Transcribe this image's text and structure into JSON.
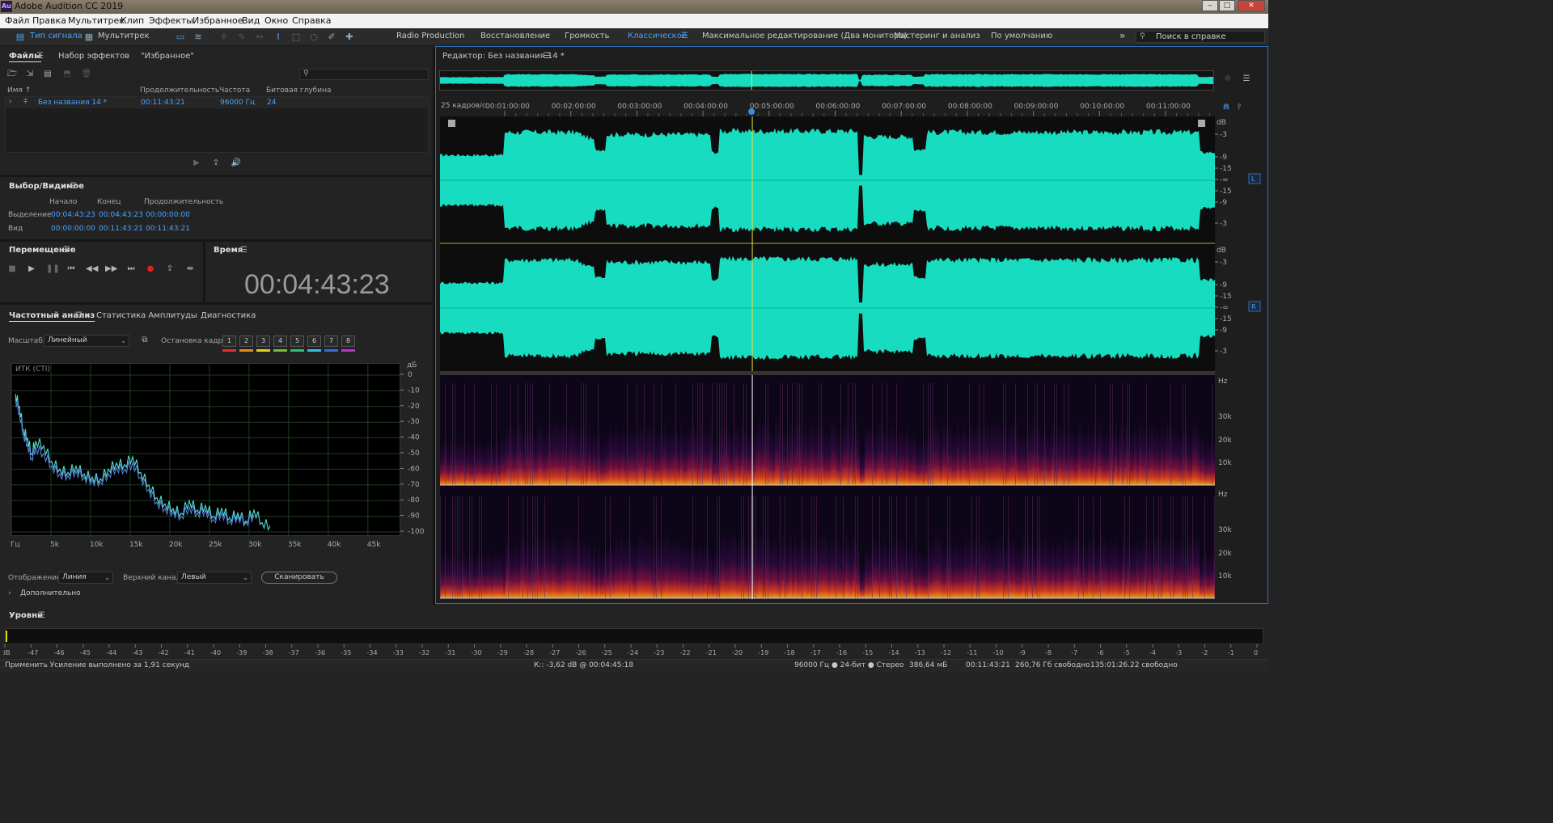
{
  "window": {
    "title": "Adobe Audition CC 2019",
    "app_icon": "Au",
    "min": "‒",
    "max": "□",
    "close": "✕"
  },
  "menu": [
    "Файл",
    "Правка",
    "Мультитрек",
    "Клип",
    "Эффекты",
    "Избранное",
    "Вид",
    "Окно",
    "Справка"
  ],
  "toolbar": {
    "waveform_mode": "Тип сигнала",
    "multitrack_mode": "Мультитрек",
    "workspaces": [
      "Radio Production",
      "Восстановление",
      "Громкость",
      "Классическое",
      "Максимальное редактирование (Два монитора)",
      "Мастеринг и анализ",
      "По умолчанию"
    ],
    "active_workspace": "Классическое",
    "more": "»",
    "search_placeholder": "Поиск в справке"
  },
  "files_panel": {
    "tabs": [
      "Файлы",
      "Набор эффектов",
      "\"Избранное\""
    ],
    "columns": [
      "Имя ↑",
      "Продолжительность",
      "Частота",
      "Битовая глубина"
    ],
    "rows": [
      {
        "name": "Без названия 14 *",
        "duration": "00:11:43:21",
        "rate": "96000 Гц",
        "depth": "24"
      }
    ]
  },
  "selection_panel": {
    "title": "Выбор/Видимое",
    "headers": [
      "Начало",
      "Конец",
      "Продолжительность"
    ],
    "rows": [
      {
        "label": "Выделение",
        "start": "00:04:43:23",
        "end": "00:04:43:23",
        "duration": "00:00:00:00"
      },
      {
        "label": "Вид",
        "start": "00:00:00:00",
        "end": "00:11:43:21",
        "duration": "00:11:43:21"
      }
    ]
  },
  "transport": {
    "title": "Перемещение"
  },
  "time_panel": {
    "title": "Время",
    "time": "00:04:43:23"
  },
  "analysis": {
    "tabs": [
      "Частотный анализ",
      "Статистика Амплитуды",
      "Диагностика"
    ],
    "scale_label": "Масштаб:",
    "scale_value": "Линейный",
    "freeze_label": "Остановка кадра:",
    "freeze_frames": [
      "1",
      "2",
      "3",
      "4",
      "5",
      "6",
      "7",
      "8"
    ],
    "freeze_colors": [
      "#e03030",
      "#e08a20",
      "#e0d020",
      "#70c030",
      "#30c070",
      "#30c0e0",
      "#3070e0",
      "#c030d0"
    ],
    "display_label": "Отображение:",
    "display_value": "Линия",
    "channel_label": "Верхний канал:",
    "channel_value": "Левый",
    "scan_label": "Сканировать",
    "more_label": "Дополнительно"
  },
  "chart_data": {
    "type": "line",
    "title": "ИТК (CTI)",
    "xlabel": "",
    "ylabel": "дБ",
    "x_ticks": [
      "Гц",
      "5k",
      "10k",
      "15k",
      "20k",
      "25k",
      "30k",
      "35k",
      "40k",
      "45k"
    ],
    "y_ticks": [
      "0",
      "-10",
      "-20",
      "-30",
      "-40",
      "-50",
      "-60",
      "-70",
      "-80",
      "-90",
      "-100"
    ],
    "xlim": [
      0,
      48000
    ],
    "ylim": [
      -100,
      0
    ],
    "grid": true,
    "series": [
      {
        "color": "#4fe0d0",
        "x": [
          500,
          1000,
          1500,
          2000,
          2500,
          3000,
          4000,
          5000,
          6000,
          7000,
          8000,
          9000,
          10000,
          11000,
          12000,
          13000,
          14000,
          15000,
          16000,
          17000,
          18000,
          19000,
          20000,
          21000,
          22000,
          23000,
          24000,
          25000,
          26000,
          27000,
          28000,
          29000,
          30000,
          31000,
          32000
        ],
        "y": [
          -12,
          -20,
          -35,
          -40,
          -50,
          -42,
          -45,
          -55,
          -60,
          -62,
          -58,
          -63,
          -65,
          -66,
          -60,
          -56,
          -57,
          -52,
          -62,
          -70,
          -78,
          -82,
          -85,
          -88,
          -80,
          -86,
          -83,
          -90,
          -85,
          -91,
          -88,
          -93,
          -86,
          -94,
          -96
        ]
      },
      {
        "color": "#5a7ad8",
        "x": [
          500,
          1000,
          1500,
          2000,
          2500,
          3000,
          4000,
          5000,
          6000,
          7000,
          8000,
          9000,
          10000,
          11000,
          12000,
          13000,
          14000,
          15000,
          16000,
          17000,
          18000,
          19000,
          20000,
          21000,
          22000,
          23000,
          24000,
          25000,
          26000,
          27000,
          28000,
          29000,
          30000
        ],
        "y": [
          -15,
          -24,
          -38,
          -44,
          -53,
          -46,
          -50,
          -58,
          -63,
          -64,
          -61,
          -65,
          -67,
          -68,
          -63,
          -59,
          -60,
          -56,
          -65,
          -73,
          -81,
          -85,
          -87,
          -90,
          -84,
          -88,
          -86,
          -92,
          -88,
          -93,
          -90,
          -94,
          -89
        ]
      }
    ]
  },
  "editor": {
    "title": "Редактор: Без названия 14 *",
    "framerate": "25 кадров/с",
    "timeline": [
      "00:01:00:00",
      "00:02:00:00",
      "00:03:00:00",
      "00:04:00:00",
      "00:05:00:00",
      "00:06:00:00",
      "00:07:00:00",
      "00:08:00:00",
      "00:09:00:00",
      "00:10:00:00",
      "00:11:00:00"
    ],
    "db_unit": "dB",
    "db_scale": [
      "-3",
      "-9",
      "-15",
      "-∞",
      "-15",
      "-9",
      "-3"
    ],
    "hz_unit": "Hz",
    "hz_scale": [
      "30k",
      "20k",
      "10k"
    ],
    "channel_left": "L",
    "channel_right": "R",
    "waveform_color": "#18dcc0",
    "playhead_fraction": 0.403
  },
  "levels": {
    "title": "Уровни",
    "scale": [
      "dB",
      "-47",
      "-46",
      "-45",
      "-44",
      "-43",
      "-42",
      "-41",
      "-40",
      "-39",
      "-38",
      "-37",
      "-36",
      "-35",
      "-34",
      "-33",
      "-32",
      "-31",
      "-30",
      "-29",
      "-28",
      "-27",
      "-26",
      "-25",
      "-24",
      "-23",
      "-22",
      "-21",
      "-20",
      "-19",
      "-18",
      "-17",
      "-16",
      "-15",
      "-14",
      "-13",
      "-12",
      "-11",
      "-10",
      "-9",
      "-8",
      "-7",
      "-6",
      "-5",
      "-4",
      "-3",
      "-2",
      "-1",
      "0"
    ]
  },
  "status": {
    "message": "Применить Усиление выполнено за 1,91 секунд",
    "cursor": "К:: -3,62 dB @ 00:04:45:18",
    "format": "96000 Гц ● 24-бит ● Стерео",
    "size": "386,64 мБ",
    "duration": "00:11:43:21",
    "free": "260,76 Гб свободно",
    "free_time": "135:01:26.22 свободно"
  }
}
